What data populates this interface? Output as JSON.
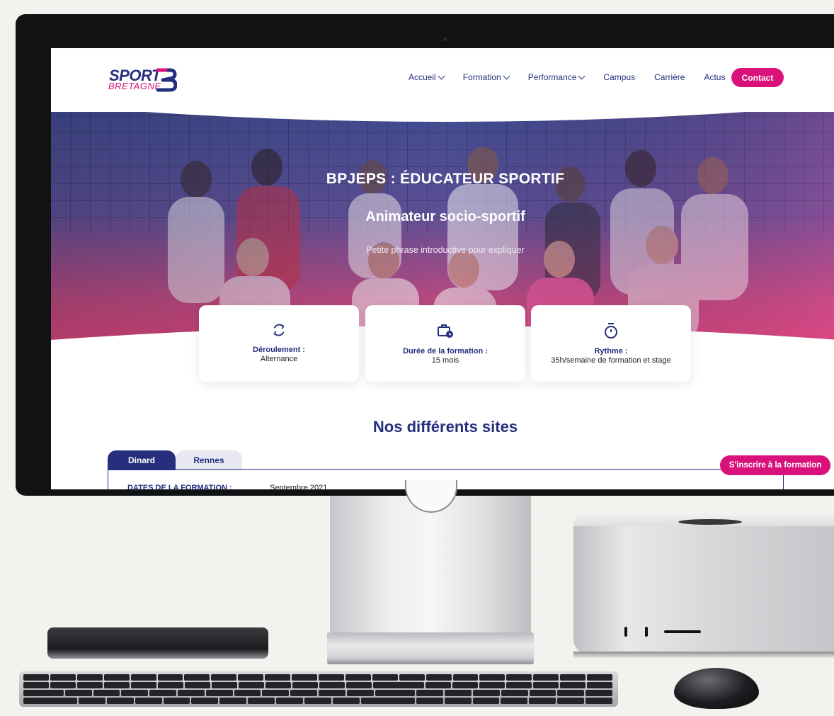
{
  "site": {
    "logo_line1": "SPORT",
    "logo_line2": "BRETAGNE",
    "nav": [
      "Accueil",
      "Formation",
      "Performance",
      "Campus",
      "Carrière",
      "Actus"
    ],
    "contact_label": "Contact"
  },
  "hero": {
    "title": "BPJEPS : ÉDUCATEUR SPORTIF",
    "subtitle": "Animateur socio-sportif",
    "intro": "Petite phrase introductive pour expliquer"
  },
  "cards": [
    {
      "icon": "cycle-arrows-icon",
      "label": "Déroulement :",
      "value": "Alternance"
    },
    {
      "icon": "briefcase-clock-icon",
      "label": "Durée de la formation :",
      "value": "15 mois"
    },
    {
      "icon": "stopwatch-icon",
      "label": "Rythme :",
      "value": "35h/semaine de formation et stage"
    }
  ],
  "sites": {
    "title": "Nos différents sites",
    "tabs": [
      "Dinard",
      "Rennes"
    ],
    "active_tab": "Dinard",
    "panel_label": "DATES DE LA FORMATION :",
    "panel_value": "Septembre 2021",
    "cta_label": "S'inscrire à la formation"
  },
  "colors": {
    "brand_navy": "#262f7e",
    "brand_pink": "#d9117b"
  }
}
